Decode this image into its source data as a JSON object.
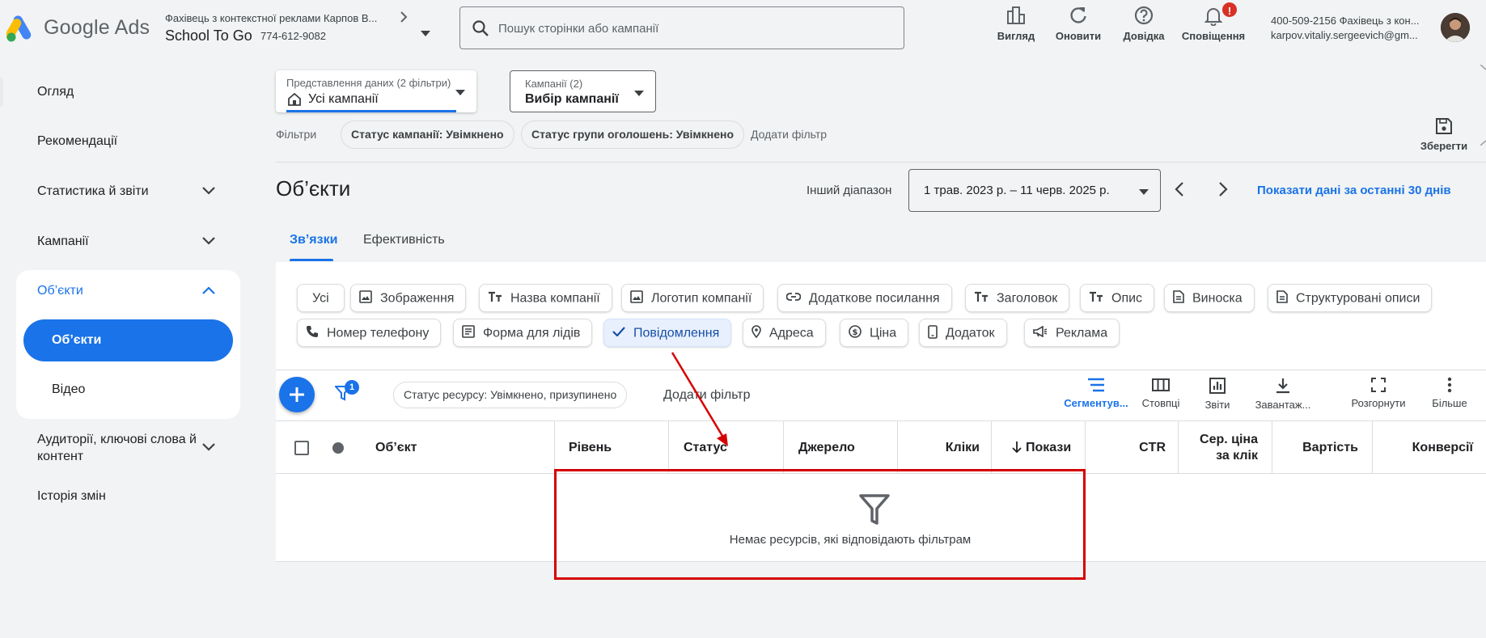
{
  "header": {
    "logo_text": "Google Ads",
    "account_name": "Фахівець з контекстної реклами Карпов В...",
    "account_sub": "School To Go",
    "account_id": "774-612-9082",
    "search_placeholder": "Пошук сторінки або кампанії",
    "buttons": [
      {
        "label": "Вигляд",
        "icon": "appearance-icon"
      },
      {
        "label": "Оновити",
        "icon": "refresh-icon"
      },
      {
        "label": "Довідка",
        "icon": "help-icon"
      },
      {
        "label": "Сповіщення",
        "icon": "bell-icon",
        "badge": "!"
      }
    ],
    "user_line1": "400-509-2156 Фахівець з кон...",
    "user_line2": "karpov.vitaliy.sergeevich@gm..."
  },
  "sidebar": {
    "items": [
      {
        "label": "Огляд"
      },
      {
        "label": "Рекомендації"
      },
      {
        "label": "Статистика й звіти"
      },
      {
        "label": "Кампанії"
      },
      {
        "label": "Об’єкти"
      },
      {
        "label": "Об’єкти"
      },
      {
        "label": "Відео"
      },
      {
        "label": "Аудиторії, ключові слова й контент"
      },
      {
        "label": "Історія змін"
      }
    ]
  },
  "controls": {
    "view_label": "Представлення даних (2 фільтри)",
    "view_value": "Усі кампанії",
    "campaign_label": "Кампанії (2)",
    "campaign_value": "Вибір кампанії",
    "filters_label": "Фільтри",
    "filter_chips": [
      "Статус кампанії: Увімкнено",
      "Статус групи оголошень: Увімкнено"
    ],
    "add_filter": "Додати фільтр",
    "save_label": "Зберегти"
  },
  "title_row": {
    "title": "Об’єкти",
    "range_label": "Інший діапазон",
    "date_range": "1 трав. 2023 р. – 11 черв. 2025 р.",
    "last30": "Показати дані за останні 30 днів"
  },
  "tabs": [
    {
      "label": "Зв’язки",
      "active": true
    },
    {
      "label": "Ефективність",
      "active": false
    }
  ],
  "type_chips": [
    {
      "label": "Усі",
      "icon": ""
    },
    {
      "label": "Зображення",
      "icon": "image-icon"
    },
    {
      "label": "Назва компанії",
      "icon": "text-icon"
    },
    {
      "label": "Логотип компанії",
      "icon": "image-icon"
    },
    {
      "label": "Додаткове посилання",
      "icon": "link-icon"
    },
    {
      "label": "Заголовок",
      "icon": "text-icon"
    },
    {
      "label": "Опис",
      "icon": "text-icon"
    },
    {
      "label": "Виноска",
      "icon": "document-icon"
    },
    {
      "label": "Структуровані описи",
      "icon": "document-icon"
    },
    {
      "label": "Номер телефону",
      "icon": "phone-icon"
    },
    {
      "label": "Форма для лідів",
      "icon": "form-icon"
    },
    {
      "label": "Повідомлення",
      "icon": "check-icon",
      "selected": true
    },
    {
      "label": "Адреса",
      "icon": "location-icon"
    },
    {
      "label": "Ціна",
      "icon": "price-icon"
    },
    {
      "label": "Додаток",
      "icon": "mobile-icon"
    },
    {
      "label": "Реклама",
      "icon": "megaphone-icon"
    }
  ],
  "toolbar": {
    "filter_badge": "1",
    "resource_chip": "Статус ресурсу: Увімкнено, призупинено",
    "add_filter": "Додати фільтр",
    "tools": [
      {
        "label": "Сегментув...",
        "icon": "segment-icon",
        "active": true
      },
      {
        "label": "Стовпці",
        "icon": "columns-icon"
      },
      {
        "label": "Звіти",
        "icon": "reports-icon"
      },
      {
        "label": "Завантаж...",
        "icon": "download-icon"
      },
      {
        "label": "Розгорнути",
        "icon": "expand-icon"
      },
      {
        "label": "Більше",
        "icon": "more-icon"
      }
    ]
  },
  "table": {
    "columns": [
      "Об’єкт",
      "Рівень",
      "Статус",
      "Джерело",
      "Кліки",
      "Покази",
      "CTR",
      "Сер. ціна за клік",
      "Вартість",
      "Конверсії"
    ],
    "sort_column": "Покази",
    "empty_message": "Немає ресурсів, які відповідають фільтрам"
  },
  "colors": {
    "accent": "#1a73e8",
    "annotation": "#d50000"
  }
}
